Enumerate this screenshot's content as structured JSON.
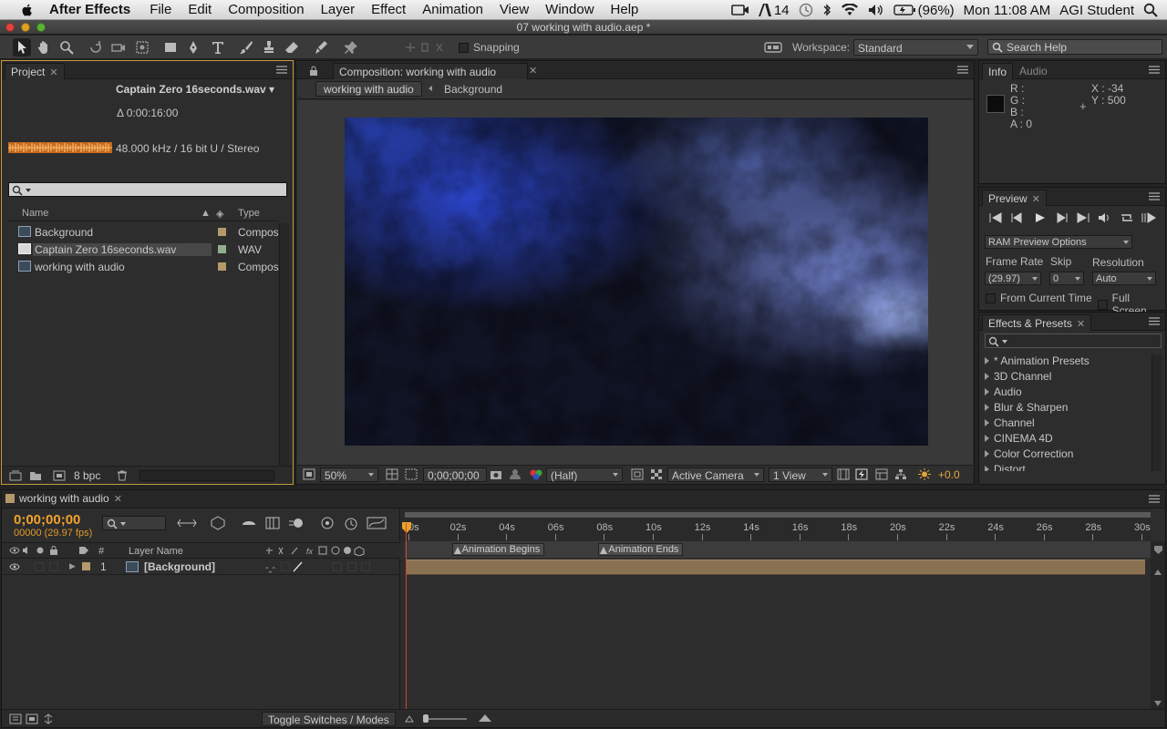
{
  "menubar": {
    "app_name": "After Effects",
    "menus": [
      "File",
      "Edit",
      "Composition",
      "Layer",
      "Effect",
      "Animation",
      "View",
      "Window",
      "Help"
    ],
    "status": {
      "adobe_count": "14",
      "battery": "(96%)",
      "clock": "Mon 11:08 AM",
      "user": "AGI Student"
    }
  },
  "window": {
    "title": "07 working with audio.aep *"
  },
  "toolbar": {
    "snapping_label": "Snapping",
    "workspace_label": "Workspace:",
    "workspace_value": "Standard",
    "search_help_placeholder": "Search Help"
  },
  "project": {
    "tab_label": "Project",
    "selected_name": "Captain Zero 16seconds.wav ▾",
    "duration": "Δ 0:00:16:00",
    "audio_info": "48.000 kHz / 16 bit U / Stereo",
    "col_name": "Name",
    "col_type": "Type",
    "items": [
      {
        "name": "Background",
        "type": "Compos",
        "label_color": "#b49a6a"
      },
      {
        "name": "Captain Zero 16seconds.wav",
        "type": "WAV",
        "label_color": "#8fb08a"
      },
      {
        "name": "working with audio",
        "type": "Compos",
        "label_color": "#b49a6a"
      }
    ],
    "bpc": "8 bpc"
  },
  "composition": {
    "tab_label": "Composition: working with audio",
    "flow_current": "working with audio",
    "flow_child": "Background",
    "zoom": "50%",
    "timecode": "0;00;00;00",
    "resolution": "(Half)",
    "camera": "Active Camera",
    "views": "1 View",
    "exposure": "+0.0"
  },
  "info": {
    "tab_label": "Info",
    "tab_audio": "Audio",
    "r": "R :",
    "g": "G :",
    "b": "B :",
    "a": "A : 0",
    "x": "X : -34",
    "y": "Y : 500"
  },
  "preview": {
    "tab_label": "Preview",
    "ram_options": "RAM Preview Options",
    "frame_rate_label": "Frame Rate",
    "skip_label": "Skip",
    "resolution_label": "Resolution",
    "frame_rate_value": "(29.97)",
    "skip_value": "0",
    "resolution_value": "Auto",
    "from_current_time": "From Current Time",
    "full_screen": "Full Screen"
  },
  "effects": {
    "tab_label": "Effects & Presets",
    "items": [
      "* Animation Presets",
      "3D Channel",
      "Audio",
      "Blur & Sharpen",
      "Channel",
      "CINEMA 4D",
      "Color Correction",
      "Distort"
    ]
  },
  "timeline": {
    "tab_label": "working with audio",
    "timecode": "0;00;00;00",
    "fps": "00000 (29.97 fps)",
    "col_number": "#",
    "col_layer_name": "Layer Name",
    "layer": {
      "number": "1",
      "name": "[Background]"
    },
    "ticks": [
      "0s",
      "02s",
      "04s",
      "06s",
      "08s",
      "10s",
      "12s",
      "14s",
      "16s",
      "18s",
      "20s",
      "22s",
      "24s",
      "26s",
      "28s",
      "30s"
    ],
    "markers": [
      {
        "label": "Animation Begins",
        "time": 2
      },
      {
        "label": "Animation Ends",
        "time": 8
      }
    ],
    "toggle_label": "Toggle Switches / Modes"
  },
  "colors": {
    "accent_orange": "#f2a22c",
    "panel_focus": "#c89b3a",
    "layer_bar": "#8a7152",
    "cti": "#d8442c"
  }
}
